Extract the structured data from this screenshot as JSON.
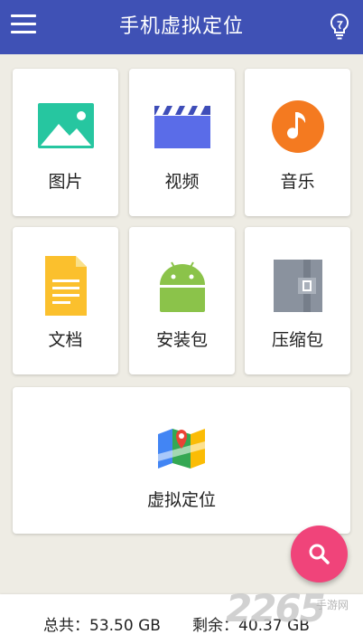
{
  "app_bar": {
    "title": "手机虚拟定位",
    "menu_icon": "hamburger-menu-icon",
    "tip_icon": "lightbulb-icon"
  },
  "categories": [
    {
      "label": "图片",
      "icon": "image-icon",
      "color": "#26C6A0"
    },
    {
      "label": "视频",
      "icon": "video-clapperboard-icon",
      "color": "#5A6CE8"
    },
    {
      "label": "音乐",
      "icon": "music-note-icon",
      "color": "#F47A20"
    },
    {
      "label": "文档",
      "icon": "document-icon",
      "color": "#FBC02D"
    },
    {
      "label": "安装包",
      "icon": "android-icon",
      "color": "#8BC34A"
    },
    {
      "label": "压缩包",
      "icon": "archive-icon",
      "color": "#8A929E"
    }
  ],
  "virtual_location": {
    "label": "虚拟定位",
    "icon": "map-pin-icon"
  },
  "fab": {
    "icon": "search-icon",
    "color": "#F0447A"
  },
  "storage": {
    "total_label": "总共：",
    "total_value": "53.50 GB",
    "free_label": "剩余：",
    "free_value": "40.37 GB"
  },
  "watermark": {
    "number": "2265",
    "text": "手游网"
  },
  "colors": {
    "app_bar": "#3F51B5",
    "background": "#EEECE4"
  }
}
